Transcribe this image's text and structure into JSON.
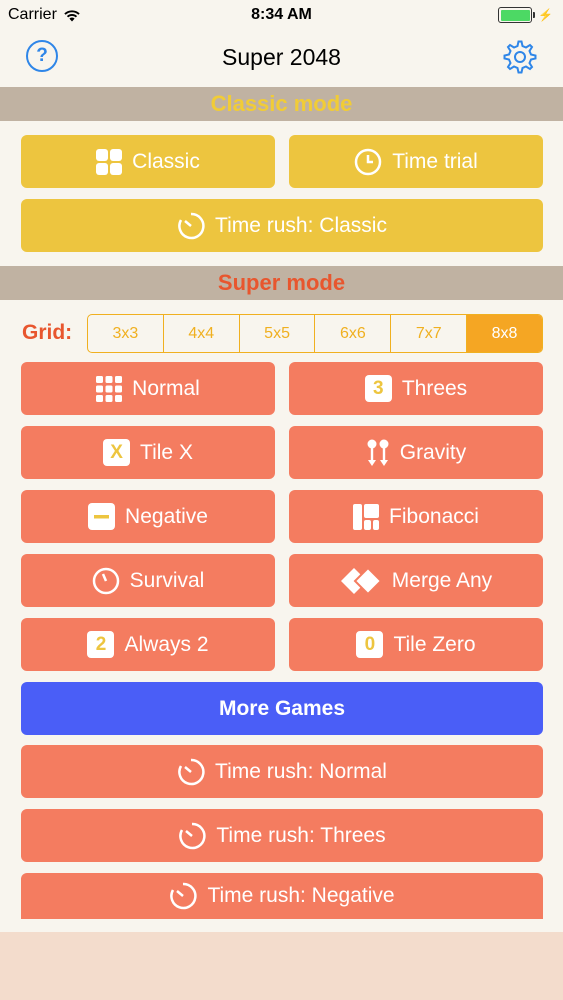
{
  "status": {
    "carrier": "Carrier",
    "time": "8:34 AM"
  },
  "nav": {
    "title": "Super 2048",
    "help_label": "?"
  },
  "classic": {
    "header": "Classic mode",
    "buttons": [
      "Classic",
      "Time trial",
      "Time rush: Classic"
    ]
  },
  "super": {
    "header": "Super mode",
    "grid_label": "Grid:",
    "grid_options": [
      "3x3",
      "4x4",
      "5x5",
      "6x6",
      "7x7",
      "8x8"
    ],
    "grid_selected": "8x8",
    "modes": [
      "Normal",
      "Threes",
      "Tile X",
      "Gravity",
      "Negative",
      "Fibonacci",
      "Survival",
      "Merge Any",
      "Always 2",
      "Tile Zero"
    ],
    "tile_glyphs": {
      "threes": "3",
      "tile_x": "X",
      "always_2": "2",
      "tile_zero": "0"
    }
  },
  "more_games": "More Games",
  "time_rush": [
    "Time rush: Normal",
    "Time rush: Threes",
    "Time rush: Negative"
  ],
  "colors": {
    "yellow_button": "#edc53f",
    "coral_button": "#f47c60",
    "blue_button": "#4a5ef7",
    "section_header_bg": "#c0b2a2",
    "classic_header_text": "#f1cc36",
    "super_header_text": "#e8562e",
    "grid_accent": "#f5a623",
    "ios_blue": "#2f86e8"
  },
  "icons": {
    "classic": "four-tiles-icon",
    "time_trial": "clock-icon",
    "time_rush": "timer-icon",
    "normal": "nine-tiles-icon",
    "gravity": "gravity-arrows-icon",
    "negative": "minus-tile-icon",
    "fibonacci": "fibonacci-tiles-icon",
    "survival": "survival-timer-icon",
    "merge_any": "merge-diamonds-icon",
    "settings": "gear-icon",
    "help": "help-icon"
  }
}
